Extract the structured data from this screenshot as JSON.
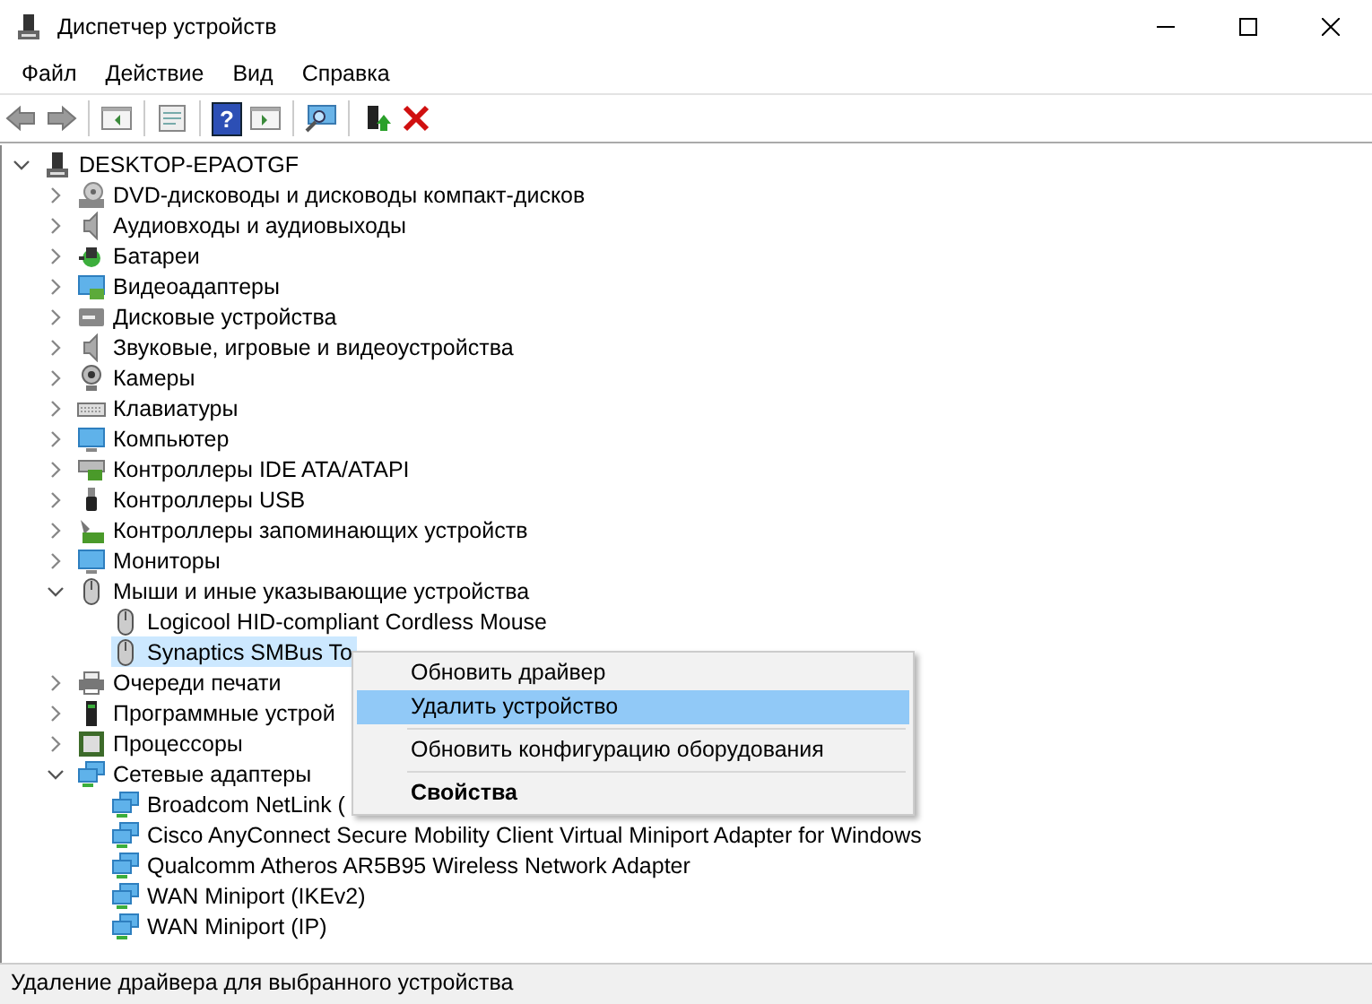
{
  "window": {
    "title": "Диспетчер устройств"
  },
  "menu_bar": [
    "Файл",
    "Действие",
    "Вид",
    "Справка"
  ],
  "toolbar": {
    "help_glyph": "?"
  },
  "tree": [
    {
      "label": "DESKTOP-EPAOTGF",
      "kind": "pc",
      "expanded": true,
      "selected": false,
      "children": [
        {
          "label": "DVD-дисководы и дисководы компакт-дисков",
          "kind": "dvd",
          "expanded": false,
          "selected": false
        },
        {
          "label": "Аудиовходы и аудиовыходы",
          "kind": "audio",
          "expanded": false,
          "selected": false
        },
        {
          "label": "Батареи",
          "kind": "battery",
          "expanded": false,
          "selected": false
        },
        {
          "label": "Видеоадаптеры",
          "kind": "display",
          "expanded": false,
          "selected": false
        },
        {
          "label": "Дисковые устройства",
          "kind": "disk",
          "expanded": false,
          "selected": false
        },
        {
          "label": "Звуковые, игровые и видеоустройства",
          "kind": "audio",
          "expanded": false,
          "selected": false
        },
        {
          "label": "Камеры",
          "kind": "camera",
          "expanded": false,
          "selected": false
        },
        {
          "label": "Клавиатуры",
          "kind": "keyboard",
          "expanded": false,
          "selected": false
        },
        {
          "label": "Компьютер",
          "kind": "monitor",
          "expanded": false,
          "selected": false
        },
        {
          "label": "Контроллеры IDE ATA/ATAPI",
          "kind": "ide",
          "expanded": false,
          "selected": false
        },
        {
          "label": "Контроллеры USB",
          "kind": "usb",
          "expanded": false,
          "selected": false
        },
        {
          "label": "Контроллеры запоминающих устройств",
          "kind": "storage",
          "expanded": false,
          "selected": false
        },
        {
          "label": "Мониторы",
          "kind": "monitor",
          "expanded": false,
          "selected": false
        },
        {
          "label": "Мыши и иные указывающие устройства",
          "kind": "mouse",
          "expanded": true,
          "selected": false,
          "children": [
            {
              "label": "Logicool HID-compliant Cordless Mouse",
              "kind": "mouse",
              "selected": false
            },
            {
              "label": "Synaptics SMBus To",
              "kind": "mouse",
              "selected": true
            }
          ]
        },
        {
          "label": "Очереди печати",
          "kind": "printer",
          "expanded": false,
          "selected": false
        },
        {
          "label": "Программные устрой",
          "kind": "software",
          "expanded": false,
          "selected": false
        },
        {
          "label": "Процессоры",
          "kind": "cpu",
          "expanded": false,
          "selected": false
        },
        {
          "label": "Сетевые адаптеры",
          "kind": "network",
          "expanded": true,
          "selected": false,
          "children": [
            {
              "label": "Broadcom NetLink (",
              "kind": "network",
              "selected": false
            },
            {
              "label": "Cisco AnyConnect Secure Mobility Client Virtual Miniport Adapter for Windows",
              "kind": "network",
              "selected": false
            },
            {
              "label": "Qualcomm Atheros AR5B95 Wireless Network Adapter",
              "kind": "network",
              "selected": false
            },
            {
              "label": "WAN Miniport (IKEv2)",
              "kind": "network",
              "selected": false
            },
            {
              "label": "WAN Miniport (IP)",
              "kind": "network",
              "selected": false
            }
          ]
        }
      ]
    }
  ],
  "context_menu": [
    {
      "kind": "item",
      "label": "Обновить драйвер",
      "selected": false,
      "bold": false
    },
    {
      "kind": "item",
      "label": "Удалить устройство",
      "selected": true,
      "bold": false
    },
    {
      "kind": "separator"
    },
    {
      "kind": "item",
      "label": "Обновить конфигурацию оборудования",
      "selected": false,
      "bold": false
    },
    {
      "kind": "separator"
    },
    {
      "kind": "item",
      "label": "Свойства",
      "selected": false,
      "bold": true
    }
  ],
  "status_bar": "Удаление драйвера для выбранного устройства"
}
